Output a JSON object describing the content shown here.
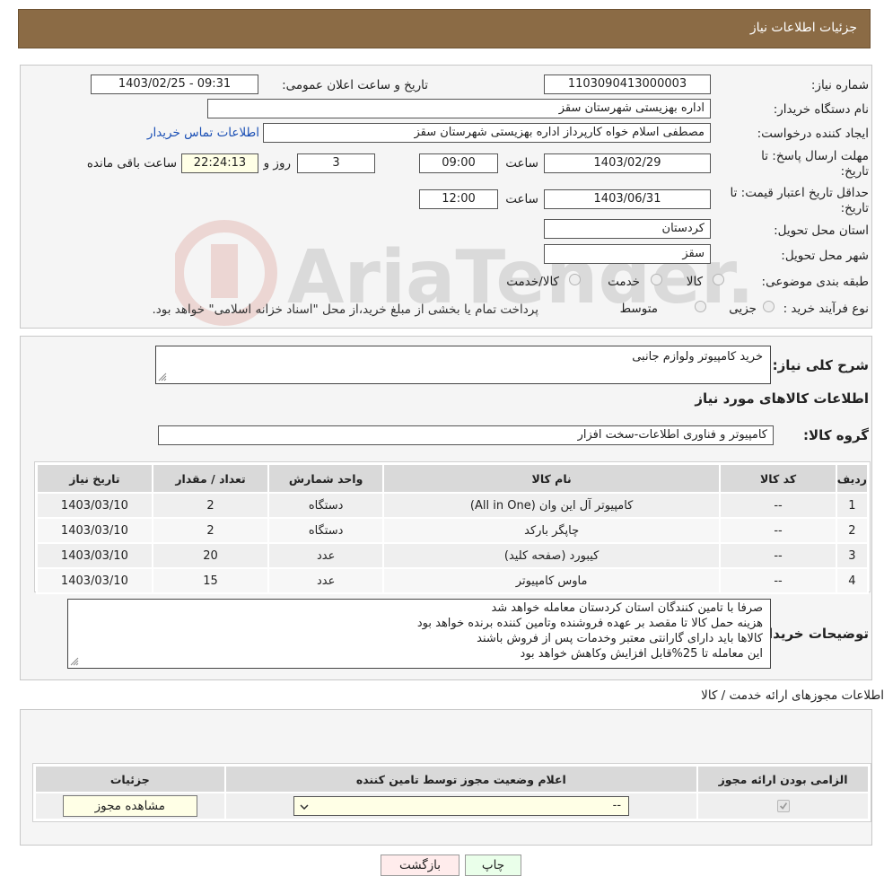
{
  "header": {
    "title": "جزئیات اطلاعات نیاز"
  },
  "form": {
    "need_no_label": "شماره نیاز:",
    "need_no": "1103090413000003",
    "announce_label": "تاریخ و ساعت اعلان عمومی:",
    "announce_value": "1403/02/25 - 09:31",
    "buyer_label": "نام دستگاه خریدار:",
    "buyer_value": "اداره بهزیستی شهرستان سقز",
    "creator_label": "ایجاد کننده درخواست:",
    "creator_value": "مصطفی  اسلام خواه  کارپرداز اداره بهزیستی شهرستان سقز",
    "contact_link": "اطلاعات تماس خریدار",
    "deadline_label_1": "مهلت ارسال پاسخ: تا",
    "deadline_label_2": "تاریخ:",
    "deadline_date": "1403/02/29",
    "time_word": "ساعت",
    "deadline_time": "09:00",
    "days_value": "3",
    "days_word": "روز و",
    "remaining_value": "22:24:13",
    "remaining_word": "ساعت باقی مانده",
    "validity_label_1": "حداقل تاریخ اعتبار قیمت: تا",
    "validity_label_2": "تاریخ:",
    "validity_date": "1403/06/31",
    "validity_time": "12:00",
    "province_label": "استان محل تحویل:",
    "province_value": "کردستان",
    "city_label": "شهر محل تحویل:",
    "city_value": "سقز",
    "category_label": "طبقه بندی موضوعی:",
    "category_options": [
      "کالا",
      "خدمت",
      "کالا/خدمت"
    ],
    "process_label": "نوع فرآیند خرید :",
    "process_options": [
      "جزیی",
      "متوسط"
    ],
    "process_note": "پرداخت تمام یا بخشی از مبلغ خرید،از محل \"اسناد خزانه اسلامی\" خواهد بود."
  },
  "summary": {
    "desc_label": "شرح کلی نیاز:",
    "desc_value": "خرید کامپیوتر ولوازم جانبی",
    "goods_title": "اطلاعات کالاهای مورد نیاز",
    "group_label": "گروه کالا:",
    "group_value": "کامپیوتر و فناوری اطلاعات-سخت افزار",
    "columns": [
      "ردیف",
      "کد کالا",
      "نام کالا",
      "واحد شمارش",
      "تعداد / مقدار",
      "تاریخ نیاز"
    ],
    "rows": [
      {
        "idx": "1",
        "code": "--",
        "name": "کامپیوتر آل این وان (All in One)",
        "unit": "دستگاه",
        "qty": "2",
        "date": "1403/03/10"
      },
      {
        "idx": "2",
        "code": "--",
        "name": "چاپگر بارکد",
        "unit": "دستگاه",
        "qty": "2",
        "date": "1403/03/10"
      },
      {
        "idx": "3",
        "code": "--",
        "name": "کیبورد (صفحه کلید)",
        "unit": "عدد",
        "qty": "20",
        "date": "1403/03/10"
      },
      {
        "idx": "4",
        "code": "--",
        "name": "ماوس کامپیوتر",
        "unit": "عدد",
        "qty": "15",
        "date": "1403/03/10"
      }
    ],
    "notes_label": "توضیحات خریدار:",
    "notes_lines": [
      "صرفا با تامین کنندگان  استان کردستان معامله خواهد شد",
      "هزینه حمل کالا تا مقصد بر عهده فروشنده وتامین کننده برنده خواهد بود",
      "کالاها باید دارای گارانتی معتبر وخدمات پس از فروش باشند",
      "این معامله تا 25%قابل افزایش وکاهش خواهد بود"
    ]
  },
  "licenses": {
    "title": "اطلاعات مجوزهای ارائه خدمت / کالا",
    "columns": [
      "الزامی بودن ارائه مجوز",
      "اعلام وضعیت مجوز توسط تامین کننده",
      "جزئیات"
    ],
    "select_value": "--",
    "view_button": "مشاهده مجوز"
  },
  "footer": {
    "print_button": "چاپ",
    "back_button": "بازگشت"
  },
  "watermark": {
    "text": "AriaTender.neT"
  }
}
